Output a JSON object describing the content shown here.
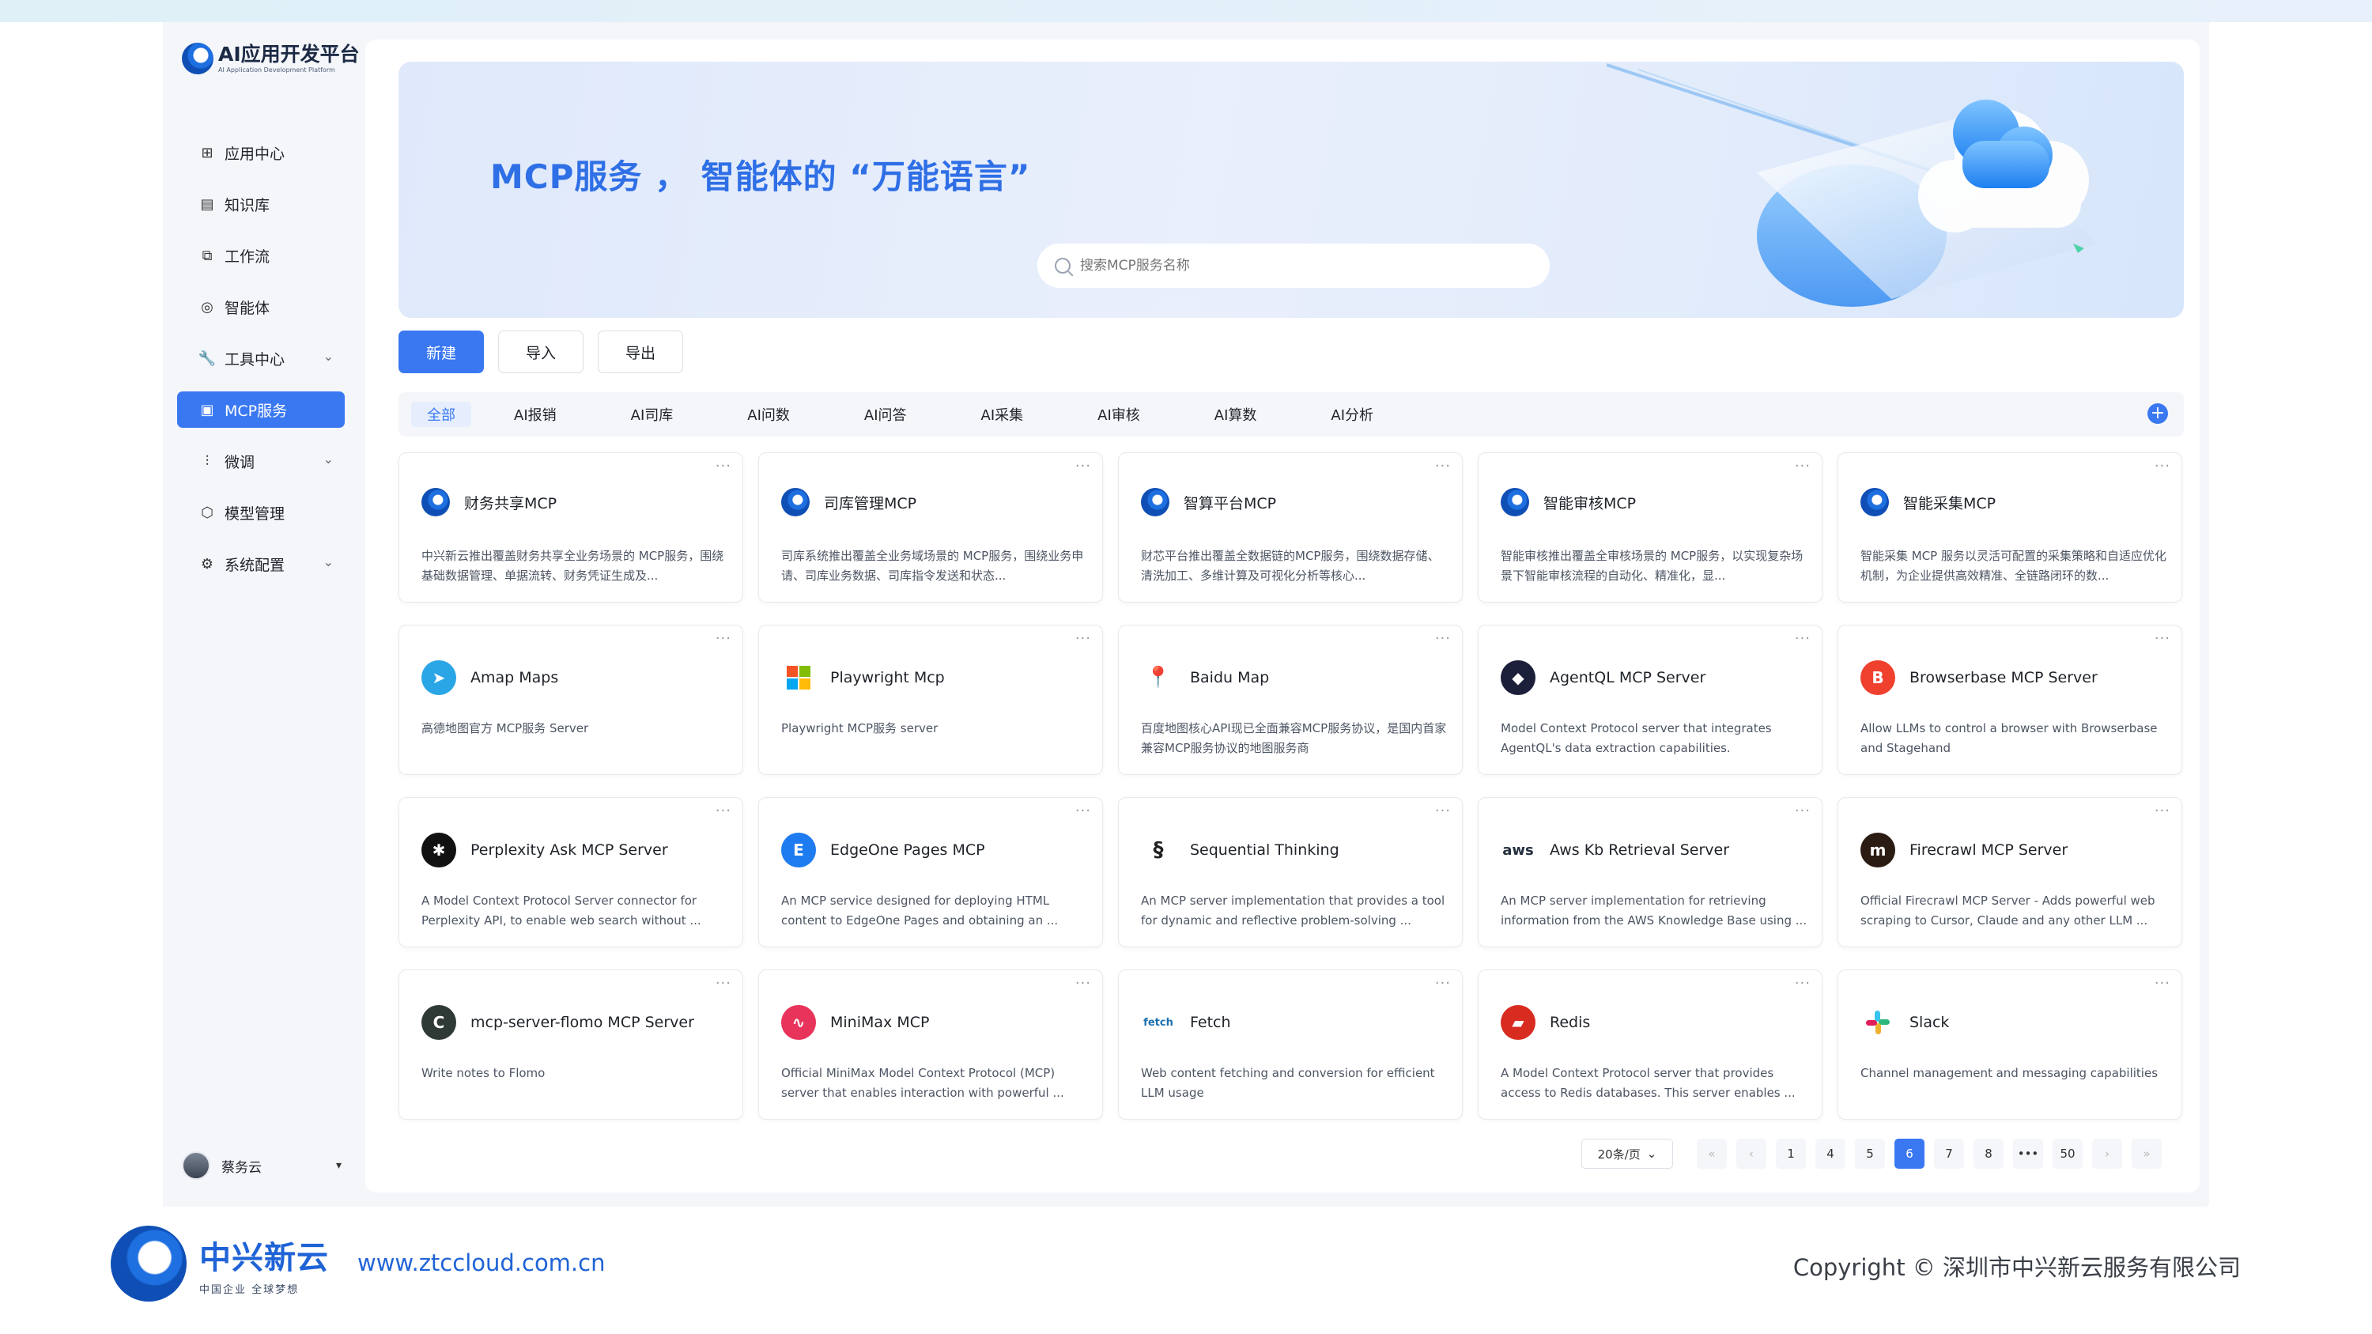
{
  "app": {
    "logo_title": "AI应用开发平台",
    "logo_subtitle": "AI Application Development Platform"
  },
  "sidebar": {
    "items": [
      {
        "label": "应用中心",
        "icon": "grid-icon",
        "active": false,
        "expand": false
      },
      {
        "label": "知识库",
        "icon": "book-icon",
        "active": false,
        "expand": false
      },
      {
        "label": "工作流",
        "icon": "flow-icon",
        "active": false,
        "expand": false
      },
      {
        "label": "智能体",
        "icon": "agent-icon",
        "active": false,
        "expand": false
      },
      {
        "label": "工具中心",
        "icon": "wrench-icon",
        "active": false,
        "expand": true
      },
      {
        "label": "MCP服务",
        "icon": "document-icon",
        "active": true,
        "expand": false
      },
      {
        "label": "微调",
        "icon": "tune-icon",
        "active": false,
        "expand": true
      },
      {
        "label": "模型管理",
        "icon": "cube-icon",
        "active": false,
        "expand": false
      },
      {
        "label": "系统配置",
        "icon": "gear-icon",
        "active": false,
        "expand": true
      }
    ],
    "user_name": "蔡务云"
  },
  "banner": {
    "title": "MCP服务 ， 智能体的 “万能语言”",
    "search_placeholder": "搜索MCP服务名称"
  },
  "toolbar": {
    "new_label": "新建",
    "import_label": "导入",
    "export_label": "导出"
  },
  "tabs": [
    "全部",
    "AI报销",
    "AI司库",
    "AI问数",
    "AI问答",
    "AI采集",
    "AI审核",
    "AI算数",
    "AI分析"
  ],
  "cards": [
    {
      "title": "财务共享MCP",
      "desc": "中兴新云推出覆盖财务共享全业务场景的 MCP服务，围绕基础数据管理、单据流转、财务凭证生成及...",
      "icon": "ztc-logo-icon",
      "color": "#1e6fe0",
      "glyph": ""
    },
    {
      "title": "司库管理MCP",
      "desc": "司库系统推出覆盖全业务域场景的 MCP服务，围绕业务申请、司库业务数据、司库指令发送和状态...",
      "icon": "ztc-logo-icon",
      "color": "#1e6fe0",
      "glyph": ""
    },
    {
      "title": "智算平台MCP",
      "desc": "财芯平台推出覆盖全数据链的MCP服务，围绕数据存储、清洗加工、多维计算及可视化分析等核心...",
      "icon": "ztc-logo-icon",
      "color": "#1e6fe0",
      "glyph": ""
    },
    {
      "title": "智能审核MCP",
      "desc": "智能审核推出覆盖全审核场景的 MCP服务，以实现复杂场景下智能审核流程的自动化、精准化，显...",
      "icon": "ztc-logo-icon",
      "color": "#1e6fe0",
      "glyph": ""
    },
    {
      "title": "智能采集MCP",
      "desc": "智能采集 MCP 服务以灵活可配置的采集策略和自适应优化机制，为企业提供高效精准、全链路闭环的数...",
      "icon": "ztc-logo-icon",
      "color": "#1e6fe0",
      "glyph": ""
    },
    {
      "title": "Amap Maps",
      "desc": "高德地图官方 MCP服务 Server",
      "icon": "amap-icon",
      "color": "#2aa6e6",
      "glyph": "➤"
    },
    {
      "title": "Playwright Mcp",
      "desc": "Playwright MCP服务 server",
      "icon": "microsoft-icon",
      "color": "#ffffff",
      "glyph": ""
    },
    {
      "title": "Baidu Map",
      "desc": "百度地图核心API现已全面兼容MCP服务协议，是国内首家兼容MCP服务协议的地图服务商",
      "icon": "map-pin-icon",
      "color": "#ffffff",
      "glyph": "📍"
    },
    {
      "title": "AgentQL MCP Server",
      "desc": "Model Context Protocol server that integrates AgentQL's data extraction capabilities.",
      "icon": "agentql-icon",
      "color": "#1b1f3a",
      "glyph": "◆"
    },
    {
      "title": "Browserbase MCP Server",
      "desc": "Allow LLMs to control a browser with Browserbase and Stagehand",
      "icon": "browserbase-icon",
      "color": "#f0412f",
      "glyph": "B"
    },
    {
      "title": "Perplexity Ask MCP Server",
      "desc": "A Model Context Protocol Server connector for Perplexity API, to enable web search without ...",
      "icon": "perplexity-icon",
      "color": "#111111",
      "glyph": "✱"
    },
    {
      "title": "EdgeOne Pages MCP",
      "desc": "An MCP service designed for deploying HTML content to EdgeOne Pages and obtaining an ...",
      "icon": "edgeone-icon",
      "color": "#1f7cf0",
      "glyph": "E"
    },
    {
      "title": "Sequential Thinking",
      "desc": "An MCP server implementation that provides a tool for dynamic and reflective problem-solving ...",
      "icon": "thinking-icon",
      "color": "#ffffff",
      "glyph": "§"
    },
    {
      "title": "Aws Kb Retrieval Server",
      "desc": "An MCP server implementation for retrieving information from the AWS Knowledge Base using ...",
      "icon": "aws-icon",
      "color": "#ffffff",
      "glyph": "aws"
    },
    {
      "title": "Firecrawl MCP Server",
      "desc": "Official Firecrawl MCP Server - Adds powerful web scraping to Cursor, Claude and any other LLM ...",
      "icon": "firecrawl-icon",
      "color": "#2a1c12",
      "glyph": "m"
    },
    {
      "title": "mcp-server-flomo MCP Server",
      "desc": "Write notes to Flomo",
      "icon": "flomo-icon",
      "color": "#2f3a36",
      "glyph": "C"
    },
    {
      "title": "MiniMax MCP",
      "desc": "Official MiniMax Model Context Protocol (MCP) server that enables interaction with powerful ...",
      "icon": "minimax-icon",
      "color": "#e8345a",
      "glyph": "∿"
    },
    {
      "title": "Fetch",
      "desc": "Web content fetching and conversion for efficient LLM usage",
      "icon": "fetch-icon",
      "color": "#ffffff",
      "glyph": "fetch"
    },
    {
      "title": "Redis",
      "desc": "A Model Context Protocol server that provides access to Redis databases. This server enables ...",
      "icon": "redis-icon",
      "color": "#d82c20",
      "glyph": "▰"
    },
    {
      "title": "Slack",
      "desc": "Channel management and messaging capabilities",
      "icon": "slack-icon",
      "color": "#ffffff",
      "glyph": "#"
    }
  ],
  "pagination": {
    "page_size": "20条/页",
    "pages": [
      "1",
      "4",
      "5",
      "6",
      "7",
      "8",
      "•••",
      "50"
    ],
    "current": "6"
  },
  "footer": {
    "brand": "中兴新云",
    "slogan": "中国企业 全球梦想",
    "url": "www.ztccloud.com.cn",
    "copyright": "Copyright © 深圳市中兴新云服务有限公司"
  }
}
